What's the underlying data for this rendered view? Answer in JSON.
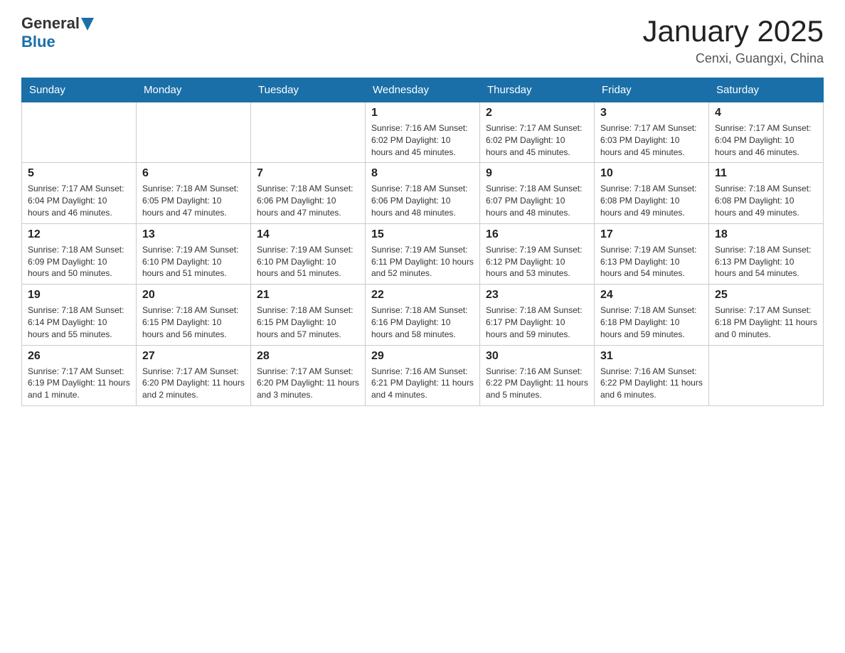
{
  "logo": {
    "general": "General",
    "blue": "Blue",
    "triangle": "▲"
  },
  "title": "January 2025",
  "location": "Cenxi, Guangxi, China",
  "weekdays": [
    "Sunday",
    "Monday",
    "Tuesday",
    "Wednesday",
    "Thursday",
    "Friday",
    "Saturday"
  ],
  "weeks": [
    [
      {
        "day": "",
        "info": ""
      },
      {
        "day": "",
        "info": ""
      },
      {
        "day": "",
        "info": ""
      },
      {
        "day": "1",
        "info": "Sunrise: 7:16 AM\nSunset: 6:02 PM\nDaylight: 10 hours\nand 45 minutes."
      },
      {
        "day": "2",
        "info": "Sunrise: 7:17 AM\nSunset: 6:02 PM\nDaylight: 10 hours\nand 45 minutes."
      },
      {
        "day": "3",
        "info": "Sunrise: 7:17 AM\nSunset: 6:03 PM\nDaylight: 10 hours\nand 45 minutes."
      },
      {
        "day": "4",
        "info": "Sunrise: 7:17 AM\nSunset: 6:04 PM\nDaylight: 10 hours\nand 46 minutes."
      }
    ],
    [
      {
        "day": "5",
        "info": "Sunrise: 7:17 AM\nSunset: 6:04 PM\nDaylight: 10 hours\nand 46 minutes."
      },
      {
        "day": "6",
        "info": "Sunrise: 7:18 AM\nSunset: 6:05 PM\nDaylight: 10 hours\nand 47 minutes."
      },
      {
        "day": "7",
        "info": "Sunrise: 7:18 AM\nSunset: 6:06 PM\nDaylight: 10 hours\nand 47 minutes."
      },
      {
        "day": "8",
        "info": "Sunrise: 7:18 AM\nSunset: 6:06 PM\nDaylight: 10 hours\nand 48 minutes."
      },
      {
        "day": "9",
        "info": "Sunrise: 7:18 AM\nSunset: 6:07 PM\nDaylight: 10 hours\nand 48 minutes."
      },
      {
        "day": "10",
        "info": "Sunrise: 7:18 AM\nSunset: 6:08 PM\nDaylight: 10 hours\nand 49 minutes."
      },
      {
        "day": "11",
        "info": "Sunrise: 7:18 AM\nSunset: 6:08 PM\nDaylight: 10 hours\nand 49 minutes."
      }
    ],
    [
      {
        "day": "12",
        "info": "Sunrise: 7:18 AM\nSunset: 6:09 PM\nDaylight: 10 hours\nand 50 minutes."
      },
      {
        "day": "13",
        "info": "Sunrise: 7:19 AM\nSunset: 6:10 PM\nDaylight: 10 hours\nand 51 minutes."
      },
      {
        "day": "14",
        "info": "Sunrise: 7:19 AM\nSunset: 6:10 PM\nDaylight: 10 hours\nand 51 minutes."
      },
      {
        "day": "15",
        "info": "Sunrise: 7:19 AM\nSunset: 6:11 PM\nDaylight: 10 hours\nand 52 minutes."
      },
      {
        "day": "16",
        "info": "Sunrise: 7:19 AM\nSunset: 6:12 PM\nDaylight: 10 hours\nand 53 minutes."
      },
      {
        "day": "17",
        "info": "Sunrise: 7:19 AM\nSunset: 6:13 PM\nDaylight: 10 hours\nand 54 minutes."
      },
      {
        "day": "18",
        "info": "Sunrise: 7:18 AM\nSunset: 6:13 PM\nDaylight: 10 hours\nand 54 minutes."
      }
    ],
    [
      {
        "day": "19",
        "info": "Sunrise: 7:18 AM\nSunset: 6:14 PM\nDaylight: 10 hours\nand 55 minutes."
      },
      {
        "day": "20",
        "info": "Sunrise: 7:18 AM\nSunset: 6:15 PM\nDaylight: 10 hours\nand 56 minutes."
      },
      {
        "day": "21",
        "info": "Sunrise: 7:18 AM\nSunset: 6:15 PM\nDaylight: 10 hours\nand 57 minutes."
      },
      {
        "day": "22",
        "info": "Sunrise: 7:18 AM\nSunset: 6:16 PM\nDaylight: 10 hours\nand 58 minutes."
      },
      {
        "day": "23",
        "info": "Sunrise: 7:18 AM\nSunset: 6:17 PM\nDaylight: 10 hours\nand 59 minutes."
      },
      {
        "day": "24",
        "info": "Sunrise: 7:18 AM\nSunset: 6:18 PM\nDaylight: 10 hours\nand 59 minutes."
      },
      {
        "day": "25",
        "info": "Sunrise: 7:17 AM\nSunset: 6:18 PM\nDaylight: 11 hours\nand 0 minutes."
      }
    ],
    [
      {
        "day": "26",
        "info": "Sunrise: 7:17 AM\nSunset: 6:19 PM\nDaylight: 11 hours\nand 1 minute."
      },
      {
        "day": "27",
        "info": "Sunrise: 7:17 AM\nSunset: 6:20 PM\nDaylight: 11 hours\nand 2 minutes."
      },
      {
        "day": "28",
        "info": "Sunrise: 7:17 AM\nSunset: 6:20 PM\nDaylight: 11 hours\nand 3 minutes."
      },
      {
        "day": "29",
        "info": "Sunrise: 7:16 AM\nSunset: 6:21 PM\nDaylight: 11 hours\nand 4 minutes."
      },
      {
        "day": "30",
        "info": "Sunrise: 7:16 AM\nSunset: 6:22 PM\nDaylight: 11 hours\nand 5 minutes."
      },
      {
        "day": "31",
        "info": "Sunrise: 7:16 AM\nSunset: 6:22 PM\nDaylight: 11 hours\nand 6 minutes."
      },
      {
        "day": "",
        "info": ""
      }
    ]
  ]
}
